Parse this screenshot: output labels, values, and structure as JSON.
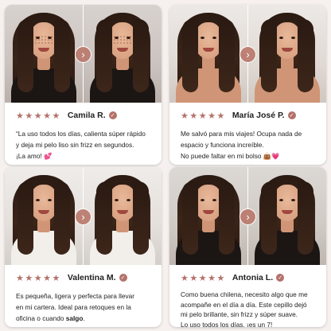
{
  "colors": {
    "accent": "#b4716a",
    "background": "#f6f1ee",
    "card": "#ffffff"
  },
  "icons": {
    "arrow": "chevron-right-icon",
    "verified": "check-badge-icon",
    "star": "star-icon"
  },
  "cards": [
    {
      "stars": "★★★★★",
      "name": "Camila R.",
      "lines": [
        "“La uso todos los días, calienta súper rápido",
        "y deja mi pelo liso sin frizz en segundos.",
        "¡La amo! "
      ],
      "emoji": "💕"
    },
    {
      "stars": "★★★★★",
      "name": "María José P.",
      "lines": [
        "Me salvó para mis viajes! Ocupa nada de",
        "espacio y funciona increíble.",
        "No puede faltar en mi bolso "
      ],
      "emoji": "👜💗"
    },
    {
      "stars": "★★★★★",
      "name": "Valentina M.",
      "lines": [
        "Es pequeña, ligera y perfecta para llevar",
        "en mi cartera. Ideal para retoques en la",
        "oficina o cuando "
      ],
      "bold": "salgo",
      "tail": "."
    },
    {
      "stars": "★★★★★",
      "name": "Antonia L.",
      "lines": [
        "Como buena chilena, necesito algo que me",
        "acompañe en el día a día. Este cepillo dejó",
        "mi pelo brillante, sin frizz y súper suave.",
        "Lo uso todos los días, ¡es un 7!"
      ]
    }
  ],
  "arrow_glyph": "›",
  "verified_glyph": "✓"
}
